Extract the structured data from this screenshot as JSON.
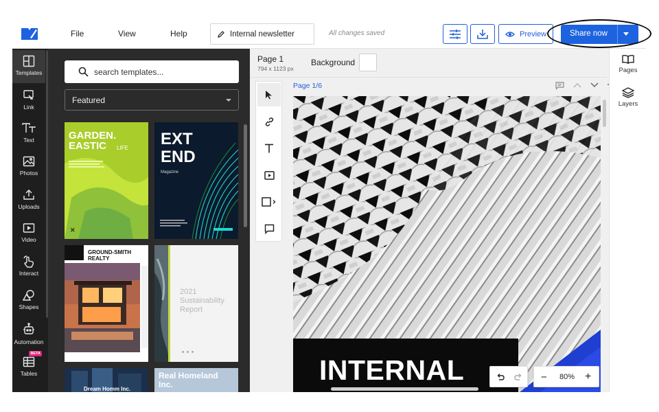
{
  "topbar": {
    "menu": [
      "File",
      "View",
      "Help"
    ],
    "document_name": "Internal newsletter",
    "save_status": "All changes saved",
    "preview_label": "Preview",
    "share_label": "Share now",
    "accent_color": "#1d63e0"
  },
  "rail": {
    "items": [
      {
        "label": "Templates",
        "icon": "templates-icon"
      },
      {
        "label": "Link",
        "icon": "link-icon"
      },
      {
        "label": "Text",
        "icon": "text-icon"
      },
      {
        "label": "Photos",
        "icon": "photos-icon"
      },
      {
        "label": "Uploads",
        "icon": "upload-icon"
      },
      {
        "label": "Video",
        "icon": "video-icon"
      },
      {
        "label": "Interact",
        "icon": "interact-icon"
      },
      {
        "label": "Shapes",
        "icon": "shapes-icon"
      },
      {
        "label": "Automation",
        "icon": "automation-icon"
      },
      {
        "label": "Tables",
        "icon": "table-icon",
        "badge": "BETA"
      }
    ]
  },
  "templates": {
    "search_placeholder": "search templates...",
    "filter_selected": "Featured",
    "cards": {
      "garden_title_1": "GARDEN.",
      "garden_title_2": "EASTIC",
      "garden_title_3": "LIFE",
      "extend_title_1": "EXT",
      "extend_title_2": "END",
      "extend_sub": "Magazine",
      "realty_title_1": "GROUND-SMITH",
      "realty_title_2": "REALTY",
      "report_year": "2021",
      "report_title_1": "Sustainability",
      "report_title_2": "Report",
      "homeland_title_1": "Real Homeland",
      "homeland_title_2": "Inc.",
      "dream_title": "Dream Homm Inc."
    }
  },
  "canvas": {
    "page_name": "Page 1",
    "page_size": "794 x 1123 px",
    "background_label": "Background",
    "page_indicator": "Page 1/6",
    "banner_text": "INTERNAL",
    "zoom": "80%"
  },
  "right_panel": {
    "pages_label": "Pages",
    "layers_label": "Layers"
  }
}
